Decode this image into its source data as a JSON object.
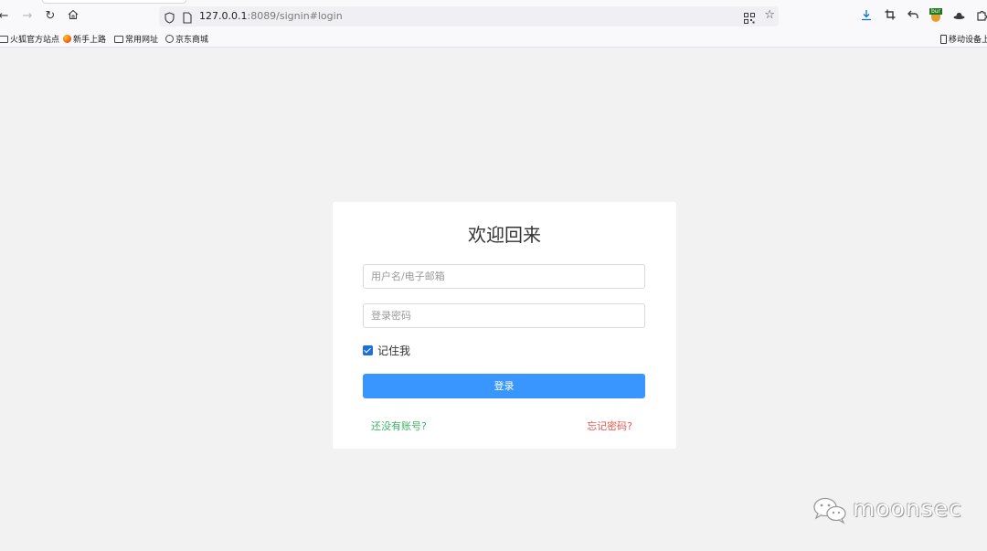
{
  "browser": {
    "url_host": "127.0.0.1",
    "url_rest": ":8089/signin#login",
    "icons": {
      "back": "back-arrow-icon",
      "forward": "forward-arrow-icon",
      "reload": "reload-icon",
      "home": "home-icon",
      "download": "download-icon",
      "crop": "crop-icon",
      "undo": "undo-icon",
      "extension": "burp-extension-icon",
      "hat": "hat-icon",
      "extensions": "extensions-icon"
    },
    "ext_label": "bur"
  },
  "bookmarks": {
    "items": [
      {
        "label": "火狐官方站点",
        "icon": "folder-icon"
      },
      {
        "label": "新手上路",
        "icon": "firefox-icon"
      },
      {
        "label": "常用网址",
        "icon": "folder-icon"
      },
      {
        "label": "京东商城",
        "icon": "globe-icon"
      }
    ],
    "mobile": "移动设备上"
  },
  "login": {
    "title": "欢迎回来",
    "username_placeholder": "用户名/电子邮箱",
    "password_placeholder": "登录密码",
    "remember_label": "记住我",
    "remember_checked": true,
    "submit_label": "登录",
    "register_link": "还没有账号?",
    "forgot_link": "忘记密码?"
  },
  "watermark": {
    "text": "moonsec",
    "icon": "wechat-icon"
  },
  "colors": {
    "primary_button": "#3a96ff",
    "register_link": "#3fb365",
    "forgot_link": "#e8564e",
    "page_bg": "#f2f2f2"
  }
}
